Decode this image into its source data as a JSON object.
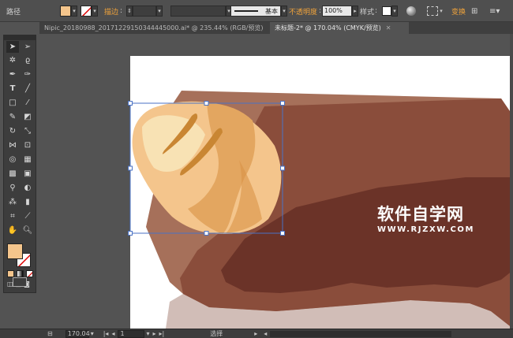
{
  "control_bar": {
    "object_label": "路径",
    "fill_color": "#f4c58c",
    "stroke_label": "描边",
    "brush_label": "基本",
    "opacity_label": "不透明度",
    "opacity_value": "100%",
    "style_label": "样式",
    "recolor_label": "变换"
  },
  "tabs": [
    {
      "label": "Nipic_20180988_20171229150344445000.ai* @ 235.44% (RGB/预览)",
      "active": false
    },
    {
      "label": "未标题-2* @ 170.04% (CMYK/预览)",
      "active": true
    }
  ],
  "toolbox": {
    "fill_color": "#f4c58c"
  },
  "status_bar": {
    "zoom": "170.04",
    "page": "1",
    "mode": "选择"
  },
  "watermark": {
    "title": "软件自学网",
    "url": "WWW.RJZXW.COM"
  },
  "colors": {
    "accent": "#f0a33b",
    "chocolate_light": "#a6705a",
    "chocolate_mid": "#8a4d3b",
    "chocolate_dark": "#6b3328",
    "bread_light": "#f4c58c",
    "bread_mid": "#e3a660",
    "bread_dark": "#c98633",
    "bread_highlight": "#f8e2b4"
  }
}
